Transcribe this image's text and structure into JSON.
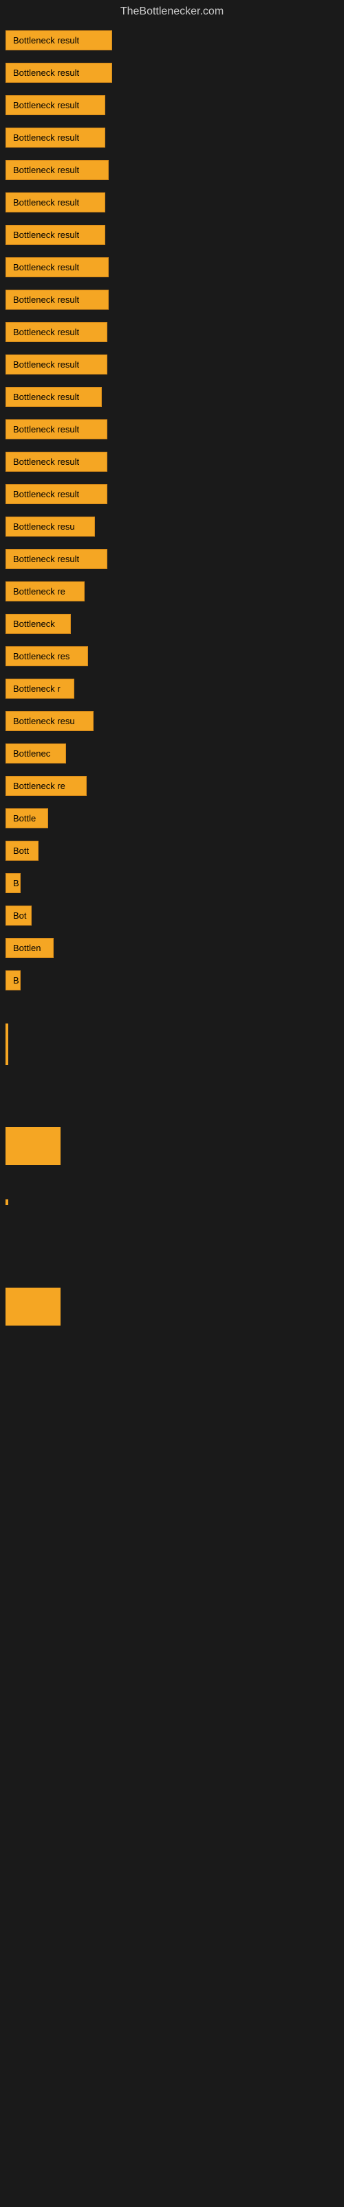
{
  "site": {
    "title": "TheBottlenecker.com"
  },
  "items": [
    {
      "label": "Bottleneck result",
      "width": 155
    },
    {
      "label": "Bottleneck result",
      "width": 155
    },
    {
      "label": "Bottleneck result",
      "width": 145
    },
    {
      "label": "Bottleneck result",
      "width": 145
    },
    {
      "label": "Bottleneck result",
      "width": 150
    },
    {
      "label": "Bottleneck result",
      "width": 145
    },
    {
      "label": "Bottleneck result",
      "width": 145
    },
    {
      "label": "Bottleneck result",
      "width": 150
    },
    {
      "label": "Bottleneck result",
      "width": 150
    },
    {
      "label": "Bottleneck result",
      "width": 148
    },
    {
      "label": "Bottleneck result",
      "width": 148
    },
    {
      "label": "Bottleneck result",
      "width": 140
    },
    {
      "label": "Bottleneck result",
      "width": 148
    },
    {
      "label": "Bottleneck result",
      "width": 148
    },
    {
      "label": "Bottleneck result",
      "width": 148
    },
    {
      "label": "Bottleneck resu",
      "width": 130
    },
    {
      "label": "Bottleneck result",
      "width": 148
    },
    {
      "label": "Bottleneck re",
      "width": 115
    },
    {
      "label": "Bottleneck",
      "width": 95
    },
    {
      "label": "Bottleneck res",
      "width": 120
    },
    {
      "label": "Bottleneck r",
      "width": 100
    },
    {
      "label": "Bottleneck resu",
      "width": 128
    },
    {
      "label": "Bottlenec",
      "width": 88
    },
    {
      "label": "Bottleneck re",
      "width": 118
    },
    {
      "label": "Bottle",
      "width": 62
    },
    {
      "label": "Bott",
      "width": 48
    },
    {
      "label": "B",
      "width": 22
    },
    {
      "label": "Bot",
      "width": 38
    },
    {
      "label": "Bottlen",
      "width": 70
    },
    {
      "label": "B",
      "width": 18
    }
  ]
}
